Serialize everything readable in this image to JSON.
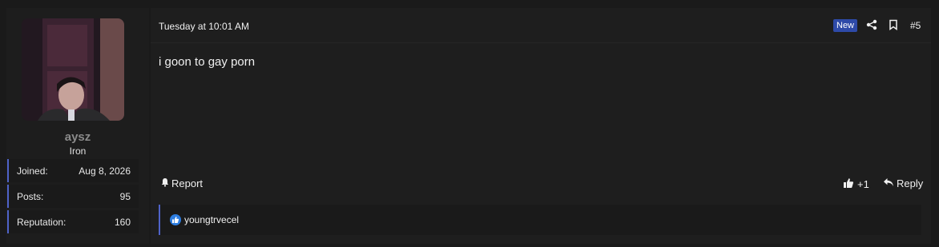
{
  "user": {
    "username": "aysz",
    "title": "Iron",
    "stats": [
      {
        "label": "Joined:",
        "value": "Aug 8, 2026"
      },
      {
        "label": "Posts:",
        "value": "95"
      },
      {
        "label": "Reputation:",
        "value": "160"
      }
    ]
  },
  "post": {
    "timestamp": "Tuesday at 10:01 AM",
    "badge": "New",
    "number": "#5",
    "body": "i goon to gay porn",
    "actions": {
      "report": "Report",
      "like_count": "+1",
      "reply": "Reply"
    },
    "reactions": {
      "user": "youngtrvecel"
    }
  },
  "colors": {
    "accent": "#4f63c8",
    "badge": "#2e4aa8",
    "reaction": "#2d7de0"
  }
}
